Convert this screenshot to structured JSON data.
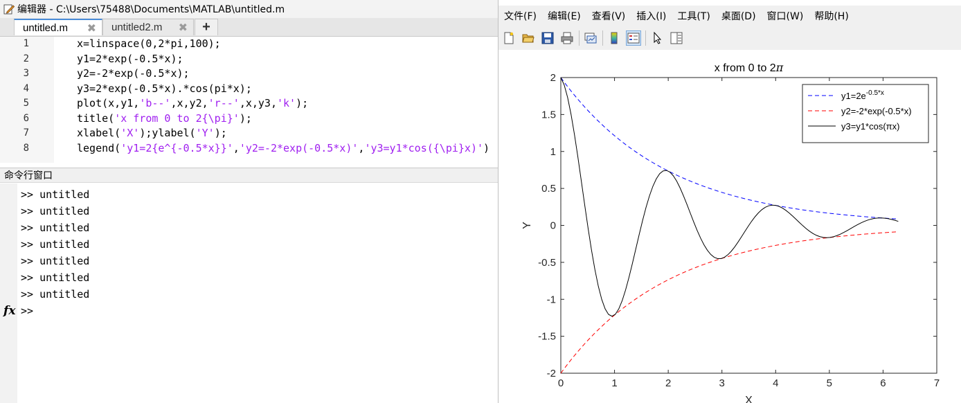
{
  "editor": {
    "title": "编辑器 - C:\\Users\\75488\\Documents\\MATLAB\\untitled.m",
    "tabs": [
      {
        "label": "untitled.m",
        "active": true
      },
      {
        "label": "untitled2.m",
        "active": false
      }
    ],
    "add_tab_label": "+",
    "close_glyph": "✖",
    "code_lines": [
      {
        "num": "1",
        "parts": [
          {
            "t": "x=linspace(0,2*pi,100);",
            "s": false
          }
        ]
      },
      {
        "num": "2",
        "parts": [
          {
            "t": "y1=2*exp(-0.5*x);",
            "s": false
          }
        ]
      },
      {
        "num": "3",
        "parts": [
          {
            "t": "y2=-2*exp(-0.5*x);",
            "s": false
          }
        ]
      },
      {
        "num": "4",
        "parts": [
          {
            "t": "y3=2*exp(-0.5*x).*cos(pi*x);",
            "s": false
          }
        ]
      },
      {
        "num": "5",
        "parts": [
          {
            "t": "plot(x,y1,",
            "s": false
          },
          {
            "t": "'b--'",
            "s": true
          },
          {
            "t": ",x,y2,",
            "s": false
          },
          {
            "t": "'r--'",
            "s": true
          },
          {
            "t": ",x,y3,",
            "s": false
          },
          {
            "t": "'k'",
            "s": true
          },
          {
            "t": ");",
            "s": false
          }
        ]
      },
      {
        "num": "6",
        "parts": [
          {
            "t": "title(",
            "s": false
          },
          {
            "t": "'x from 0 to 2{\\pi}'",
            "s": true
          },
          {
            "t": ");",
            "s": false
          }
        ]
      },
      {
        "num": "7",
        "parts": [
          {
            "t": "xlabel(",
            "s": false
          },
          {
            "t": "'X'",
            "s": true
          },
          {
            "t": ");ylabel(",
            "s": false
          },
          {
            "t": "'Y'",
            "s": true
          },
          {
            "t": ");",
            "s": false
          }
        ]
      },
      {
        "num": "8",
        "parts": [
          {
            "t": "legend(",
            "s": false
          },
          {
            "t": "'y1=2{e^{-0.5*x}}'",
            "s": true
          },
          {
            "t": ",",
            "s": false
          },
          {
            "t": "'y2=-2*exp(-0.5*x)'",
            "s": true
          },
          {
            "t": ",",
            "s": false
          },
          {
            "t": "'y3=y1*cos({\\pi}x)'",
            "s": true
          },
          {
            "t": ")",
            "s": false
          }
        ]
      }
    ]
  },
  "command_window": {
    "header": "命令行窗口",
    "history": [
      ">> untitled",
      ">> untitled",
      ">> untitled",
      ">> untitled",
      ">> untitled",
      ">> untitled",
      ">> untitled"
    ],
    "prompt": ">>",
    "fx_label": "fx"
  },
  "figure": {
    "menus": [
      "文件(F)",
      "编辑(E)",
      "查看(V)",
      "插入(I)",
      "工具(T)",
      "桌面(D)",
      "窗口(W)",
      "帮助(H)"
    ],
    "toolbar_icons": [
      "new-figure-icon",
      "open-file-icon",
      "save-icon",
      "print-icon",
      "link-plot-icon",
      "colorbar-icon",
      "legend-icon",
      "pointer-icon",
      "property-editor-icon"
    ]
  },
  "chart_data": {
    "type": "line",
    "title_prefix": "x from 0 to 2",
    "title_symbol": "π",
    "xlabel": "X",
    "ylabel": "Y",
    "xlim": [
      0,
      7
    ],
    "ylim": [
      -2,
      2
    ],
    "xticks": [
      0,
      1,
      2,
      3,
      4,
      5,
      6,
      7
    ],
    "yticks": [
      -2,
      -1.5,
      -1,
      -0.5,
      0,
      0.5,
      1,
      1.5,
      2
    ],
    "x_range": [
      0,
      6.283185307
    ],
    "n_points": 100,
    "legend_position": "top-right",
    "series": [
      {
        "name": "y1=2e^{-0.5*x}",
        "legend_main": "y1=2e",
        "legend_sup": "-0.5*x",
        "expr": "y1",
        "color": "#0000ff",
        "style": "dashed"
      },
      {
        "name": "y2=-2*exp(-0.5*x)",
        "legend_main": "y2=-2*exp(-0.5*x)",
        "legend_sup": "",
        "expr": "y2",
        "color": "#ff0000",
        "style": "dashed"
      },
      {
        "name": "y3=y1*cos(πx)",
        "legend_main": "y3=y1*cos(πx)",
        "legend_sup": "",
        "expr": "y3",
        "color": "#000000",
        "style": "solid"
      }
    ]
  }
}
